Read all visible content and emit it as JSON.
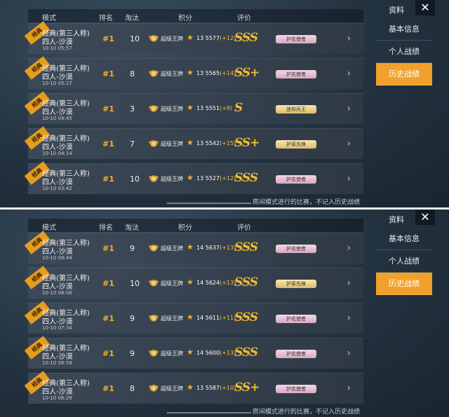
{
  "panels": [
    {
      "sidebar": {
        "title": "资料",
        "close": "✕",
        "items": [
          "基本信息",
          "个人战绩",
          "历史战绩"
        ]
      },
      "headers": {
        "mode": "模式",
        "rank": "排名",
        "elim": "淘汰",
        "score": "积分",
        "eval": "评价"
      },
      "rows": [
        {
          "tag": "经典",
          "mode1": "经典(第三人称)",
          "mode2": "四人-沙漠",
          "time": "10-10 05:57",
          "rank": "#1",
          "elim": "10",
          "title": "超级王牌",
          "score": "13 5577",
          "delta": "(+12)",
          "grade": "SSS",
          "medal": "护花使者",
          "medal_color": "pink"
        },
        {
          "tag": "经典",
          "mode1": "经典(第三人称)",
          "mode2": "四人-沙漠",
          "time": "10-10 05:17",
          "rank": "#1",
          "elim": "8",
          "title": "超级王牌",
          "score": "13 5565",
          "delta": "(+14)",
          "grade": "SS+",
          "medal": "护花使者",
          "medal_color": "pink"
        },
        {
          "tag": "经典",
          "mode1": "经典(第三人称)",
          "mode2": "四人-沙漠",
          "time": "10-10 04:45",
          "rank": "#1",
          "elim": "3",
          "title": "超级王牌",
          "score": "13 5551",
          "delta": "(+9)",
          "grade": "S",
          "medal": "迷你兵王",
          "medal_color": "gold"
        },
        {
          "tag": "经典",
          "mode1": "经典(第三人称)",
          "mode2": "四人-沙漠",
          "time": "10-10 04:14",
          "rank": "#1",
          "elim": "7",
          "title": "超级王牌",
          "score": "13 5542",
          "delta": "(+15)",
          "grade": "SS+",
          "medal": "护草先锋",
          "medal_color": "gold"
        },
        {
          "tag": "经典",
          "mode1": "经典(第三人称)",
          "mode2": "四人-沙漠",
          "time": "10-10 03:42",
          "rank": "#1",
          "elim": "10",
          "title": "超级王牌",
          "score": "13 5527",
          "delta": "(+12)",
          "grade": "SSS",
          "medal": "护花使者",
          "medal_color": "pink"
        }
      ],
      "footer": "房间模式进行的比赛，不记入历史战绩"
    },
    {
      "sidebar": {
        "title": "资料",
        "close": "✕",
        "items": [
          "基本信息",
          "个人战绩",
          "历史战绩"
        ]
      },
      "headers": {
        "mode": "模式",
        "rank": "排名",
        "elim": "淘汰",
        "score": "积分",
        "eval": "评价"
      },
      "rows": [
        {
          "tag": "经典",
          "mode1": "经典(第三人称)",
          "mode2": "四人-沙漠",
          "time": "10-10 08:44",
          "rank": "#1",
          "elim": "9",
          "title": "超级王牌",
          "score": "14 5637",
          "delta": "(+13)",
          "grade": "SSS",
          "medal": "护花使者",
          "medal_color": "pink"
        },
        {
          "tag": "经典",
          "mode1": "经典(第三人称)",
          "mode2": "四人-沙漠",
          "time": "10-10 08:06",
          "rank": "#1",
          "elim": "10",
          "title": "超级王牌",
          "score": "14 5624",
          "delta": "(+13)",
          "grade": "SSS",
          "medal": "护草先锋",
          "medal_color": "gold"
        },
        {
          "tag": "经典",
          "mode1": "经典(第三人称)",
          "mode2": "四人-沙漠",
          "time": "10-10 07:34",
          "rank": "#1",
          "elim": "9",
          "title": "超级王牌",
          "score": "14 5611",
          "delta": "(+11)",
          "grade": "SSS",
          "medal": "护花使者",
          "medal_color": "pink"
        },
        {
          "tag": "经典",
          "mode1": "经典(第三人称)",
          "mode2": "四人-沙漠",
          "time": "10-10 06:59",
          "rank": "#1",
          "elim": "9",
          "title": "超级王牌",
          "score": "14 5600",
          "delta": "(+13)",
          "grade": "SSS",
          "medal": "护花使者",
          "medal_color": "pink"
        },
        {
          "tag": "经典",
          "mode1": "经典(第三人称)",
          "mode2": "四人-沙漠",
          "time": "10-10 06:29",
          "rank": "#1",
          "elim": "8",
          "title": "超级王牌",
          "score": "13 5587",
          "delta": "(+10)",
          "grade": "SS+",
          "medal": "护花使者",
          "medal_color": "pink"
        }
      ],
      "footer": "房间模式进行的比赛，不记入历史战绩"
    }
  ]
}
